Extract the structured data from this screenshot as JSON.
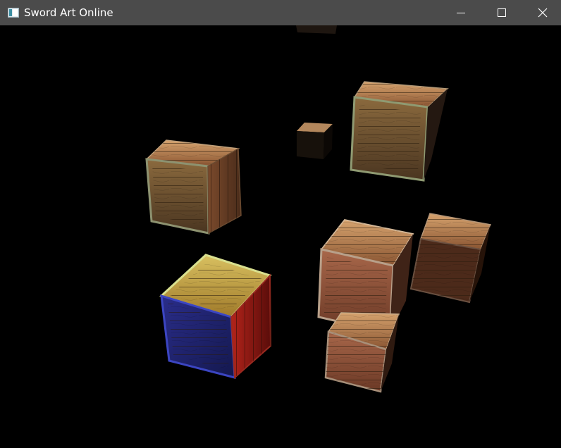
{
  "window": {
    "title": "Sword Art Online",
    "app_icon": "window-app-icon",
    "controls": [
      {
        "name": "minimize-button",
        "icon": "minimize-icon"
      },
      {
        "name": "maximize-button",
        "icon": "maximize-icon"
      },
      {
        "name": "close-button",
        "icon": "close-icon"
      }
    ]
  },
  "scene": {
    "background": "#000000",
    "object_type": "wooden-crate",
    "crate_count": 8,
    "colors": {
      "wood_light": "#c08a5a",
      "wood_dark": "#5b3521",
      "rim_tint": "#8f9a72",
      "blue_light": "#3237a8",
      "red_light": "#c0261f"
    }
  }
}
